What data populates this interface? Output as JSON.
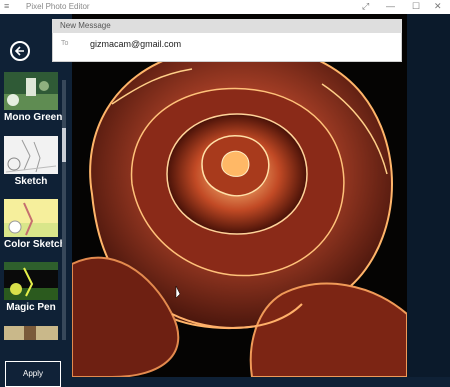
{
  "app": {
    "title": "Pixel Photo Editor",
    "controls": {
      "minimize": "—",
      "maximize": "☐",
      "close": "✕"
    }
  },
  "sidebar": {
    "back_icon": "back-arrow-icon",
    "filters": [
      {
        "label": "Mono Green"
      },
      {
        "label": "Sketch"
      },
      {
        "label": "Color Sketch"
      },
      {
        "label": "Magic Pen"
      }
    ],
    "apply_label": "Apply"
  },
  "message": {
    "header": "New Message",
    "to_label": "To",
    "to_value": "gizmacam@gmail.com"
  },
  "colors": {
    "background": "#0f2136",
    "accent": "#ffffff",
    "rose": "#c44a2c"
  }
}
